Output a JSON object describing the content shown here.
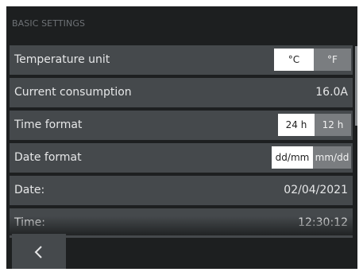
{
  "header": {
    "title": "BASIC SETTINGS"
  },
  "settings": {
    "temperature": {
      "label": "Temperature unit",
      "options": [
        "°C",
        "°F"
      ],
      "selected": "°C"
    },
    "consumption": {
      "label": "Current consumption",
      "value": "16.0A"
    },
    "time_format": {
      "label": "Time format",
      "options": [
        "24 h",
        "12 h"
      ],
      "selected": "24 h"
    },
    "date_format": {
      "label": "Date format",
      "options": [
        "dd/mm",
        "mm/dd"
      ],
      "selected": "dd/mm"
    },
    "date": {
      "label": "Date:",
      "value": "02/04/2021"
    },
    "time": {
      "label": "Time:",
      "value": "12:30:12"
    }
  },
  "footer": {
    "back_icon": "chevron-left-icon"
  },
  "colors": {
    "background": "#1d1f20",
    "row": "#45494c",
    "active": "#ffffff",
    "inactive": "#7a7d80"
  }
}
